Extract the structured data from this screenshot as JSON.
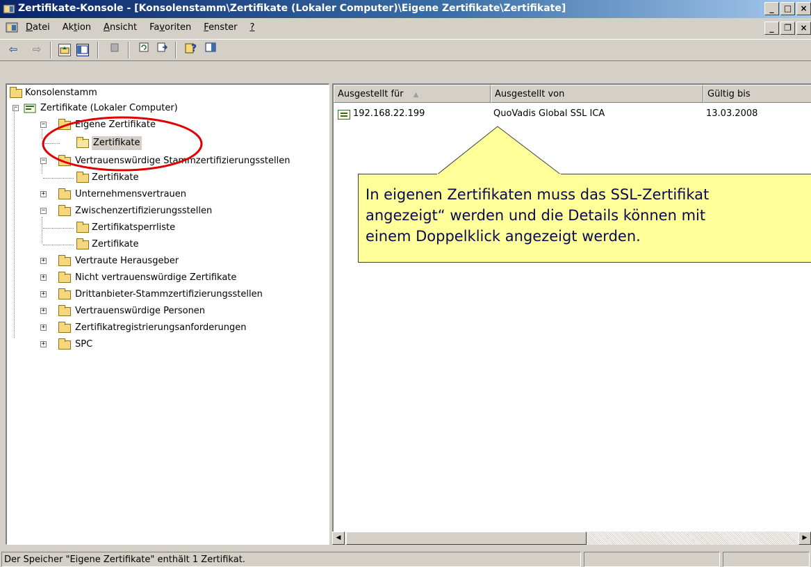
{
  "window": {
    "title": "Zertifikate-Konsole - [Konsolenstamm\\Zertifikate (Lokaler Computer)\\Eigene Zertifikate\\Zertifikate]",
    "app_icon": "mmc-console-icon"
  },
  "menu": {
    "items": [
      {
        "label": "Datei",
        "accel": "D",
        "rest": "atei"
      },
      {
        "label": "Aktion",
        "pre": "Ak",
        "accel": "t",
        "rest": "ion"
      },
      {
        "label": "Ansicht",
        "accel": "A",
        "rest": "nsicht"
      },
      {
        "label": "Favoriten",
        "pre": "Fa",
        "accel": "v",
        "rest": "oriten"
      },
      {
        "label": "Fenster",
        "accel": "F",
        "rest": "enster"
      },
      {
        "label": "?",
        "accel": "?",
        "rest": ""
      }
    ]
  },
  "toolbar": {
    "icons": [
      "back-arrow-icon",
      "forward-arrow-icon",
      "up-folder-icon",
      "show-hide-tree-icon",
      "delete-icon",
      "refresh-icon",
      "export-list-icon",
      "help-icon",
      "action-pane-icon"
    ]
  },
  "tree": {
    "root": "Konsolenstamm",
    "computer": "Zertifikate (Lokaler Computer)",
    "nodes": [
      {
        "label": "Eigene Zertifikate",
        "expanded": true
      },
      {
        "label": "Zertifikate",
        "selected": true
      },
      {
        "label": "Vertrauenswürdige Stammzertifizierungsstellen",
        "expanded": true
      },
      {
        "label": "Zertifikate"
      },
      {
        "label": "Unternehmensvertrauen",
        "expanded": false
      },
      {
        "label": "Zwischenzertifizierungsstellen",
        "expanded": true
      },
      {
        "label": "Zertifikatsperrliste"
      },
      {
        "label": "Zertifikate"
      },
      {
        "label": "Vertraute Herausgeber",
        "expanded": false
      },
      {
        "label": "Nicht vertrauenswürdige Zertifikate",
        "expanded": false
      },
      {
        "label": "Drittanbieter-Stammzertifizierungsstellen",
        "expanded": false
      },
      {
        "label": "Vertrauenswürdige Personen",
        "expanded": false
      },
      {
        "label": "Zertifikatregistrierungsanforderungen",
        "expanded": false
      },
      {
        "label": "SPC",
        "expanded": false
      }
    ]
  },
  "list": {
    "columns": [
      "Ausgestellt für",
      "Ausgestellt von",
      "Gültig bis"
    ],
    "sort_indicator": "▲",
    "rows": [
      {
        "issued_to": "192.168.22.199",
        "issued_by": "QuoVadis Global SSL ICA",
        "valid_until": "13.03.2008"
      }
    ]
  },
  "status": {
    "text": "Der Speicher \"Eigene Zertifikate\" enthält 1 Zertifikat."
  },
  "callout": {
    "line1": "In eigenen Zertifikaten muss das SSL-Zertifikat",
    "line2": "angezeigt“ werden und die Details können mit",
    "line3": "einem Doppelklick angezeigt werden."
  },
  "colors": {
    "titlebar": "#0a246a",
    "callout_fill": "#ffff99",
    "highlight_oval": "#e00000"
  }
}
